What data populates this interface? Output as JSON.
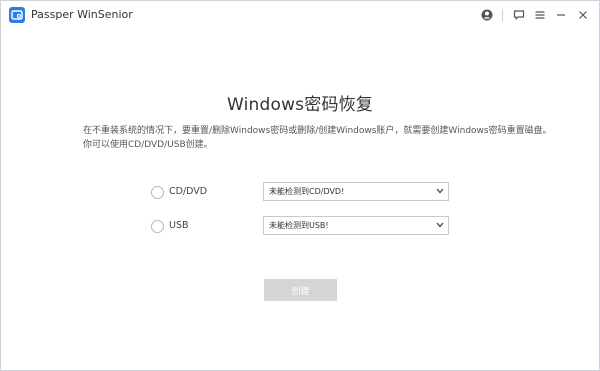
{
  "app": {
    "title": "Passper WinSenior"
  },
  "titlebar": {
    "icons": [
      "account-icon",
      "feedback-icon",
      "menu-icon",
      "minimize-icon",
      "close-icon"
    ]
  },
  "main": {
    "heading": "Windows密码恢复",
    "description_line1": "在不重装系统的情况下，要重置/删除Windows密码或删除/创建Windows账户，就需要创建Windows密码重置磁盘。",
    "description_line2": "你可以使用CD/DVD/USB创建。",
    "options": [
      {
        "label": "CD/DVD",
        "select_value": "未能检测到CD/DVD!"
      },
      {
        "label": "USB",
        "select_value": "未能检测到USB!"
      }
    ],
    "create_label": "创建"
  },
  "colors": {
    "accent": "#2b7de9",
    "disabled_button": "#d5d5d5"
  }
}
